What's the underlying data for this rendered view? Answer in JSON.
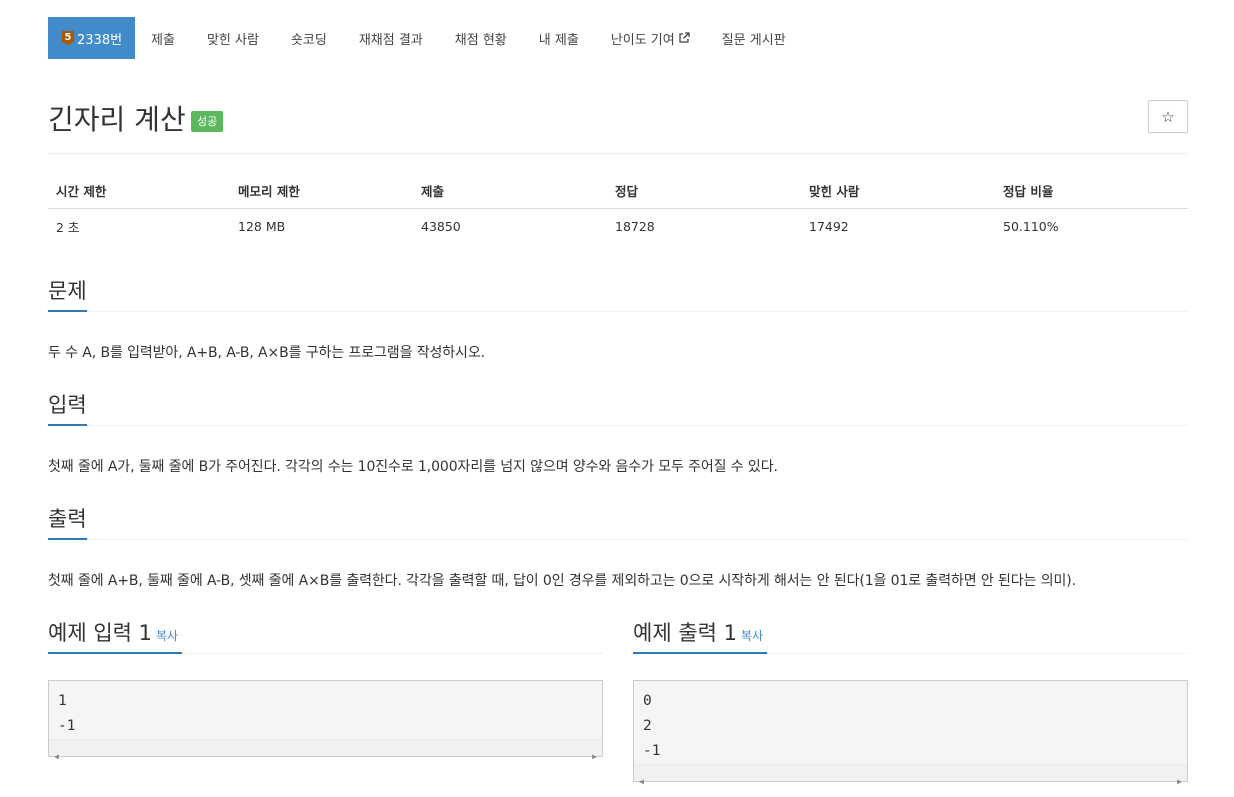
{
  "nav": {
    "problem_number": "2338번",
    "tier_level": "5",
    "items": [
      "제출",
      "맞힌 사람",
      "숏코딩",
      "재채점 결과",
      "채점 현황",
      "내 제출",
      "난이도 기여",
      "질문 게시판"
    ]
  },
  "problem": {
    "title": "긴자리 계산",
    "status_badge": "성공",
    "star_icon": "☆"
  },
  "info_table": {
    "headers": [
      "시간 제한",
      "메모리 제한",
      "제출",
      "정답",
      "맞힌 사람",
      "정답 비율"
    ],
    "values": [
      "2 초",
      "128 MB",
      "43850",
      "18728",
      "17492",
      "50.110%"
    ]
  },
  "sections": {
    "description": {
      "heading": "문제",
      "text": "두 수 A, B를 입력받아, A+B, A-B, A×B를 구하는 프로그램을 작성하시오."
    },
    "input": {
      "heading": "입력",
      "text": "첫째 줄에 A가, 둘째 줄에 B가 주어진다. 각각의 수는 10진수로 1,000자리를 넘지 않으며 양수와 음수가 모두 주어질 수 있다."
    },
    "output": {
      "heading": "출력",
      "text": "첫째 줄에 A+B, 둘째 줄에 A-B, 셋째 줄에 A×B를 출력한다. 각각을 출력할 때, 답이 0인 경우를 제외하고는 0으로 시작하게 해서는 안 된다(1을 01로 출력하면 안 된다는 의미)."
    }
  },
  "samples": {
    "input": {
      "heading": "예제 입력 1",
      "copy_label": "복사",
      "lines": [
        "1",
        "-1"
      ]
    },
    "output": {
      "heading": "예제 출력 1",
      "copy_label": "복사",
      "lines": [
        "0",
        "2",
        "-1"
      ]
    }
  },
  "colors": {
    "nav_active": "#428bca",
    "success": "#5cb85c",
    "heading_underline": "#2f77b5",
    "tier_badge": "#ad5600"
  }
}
